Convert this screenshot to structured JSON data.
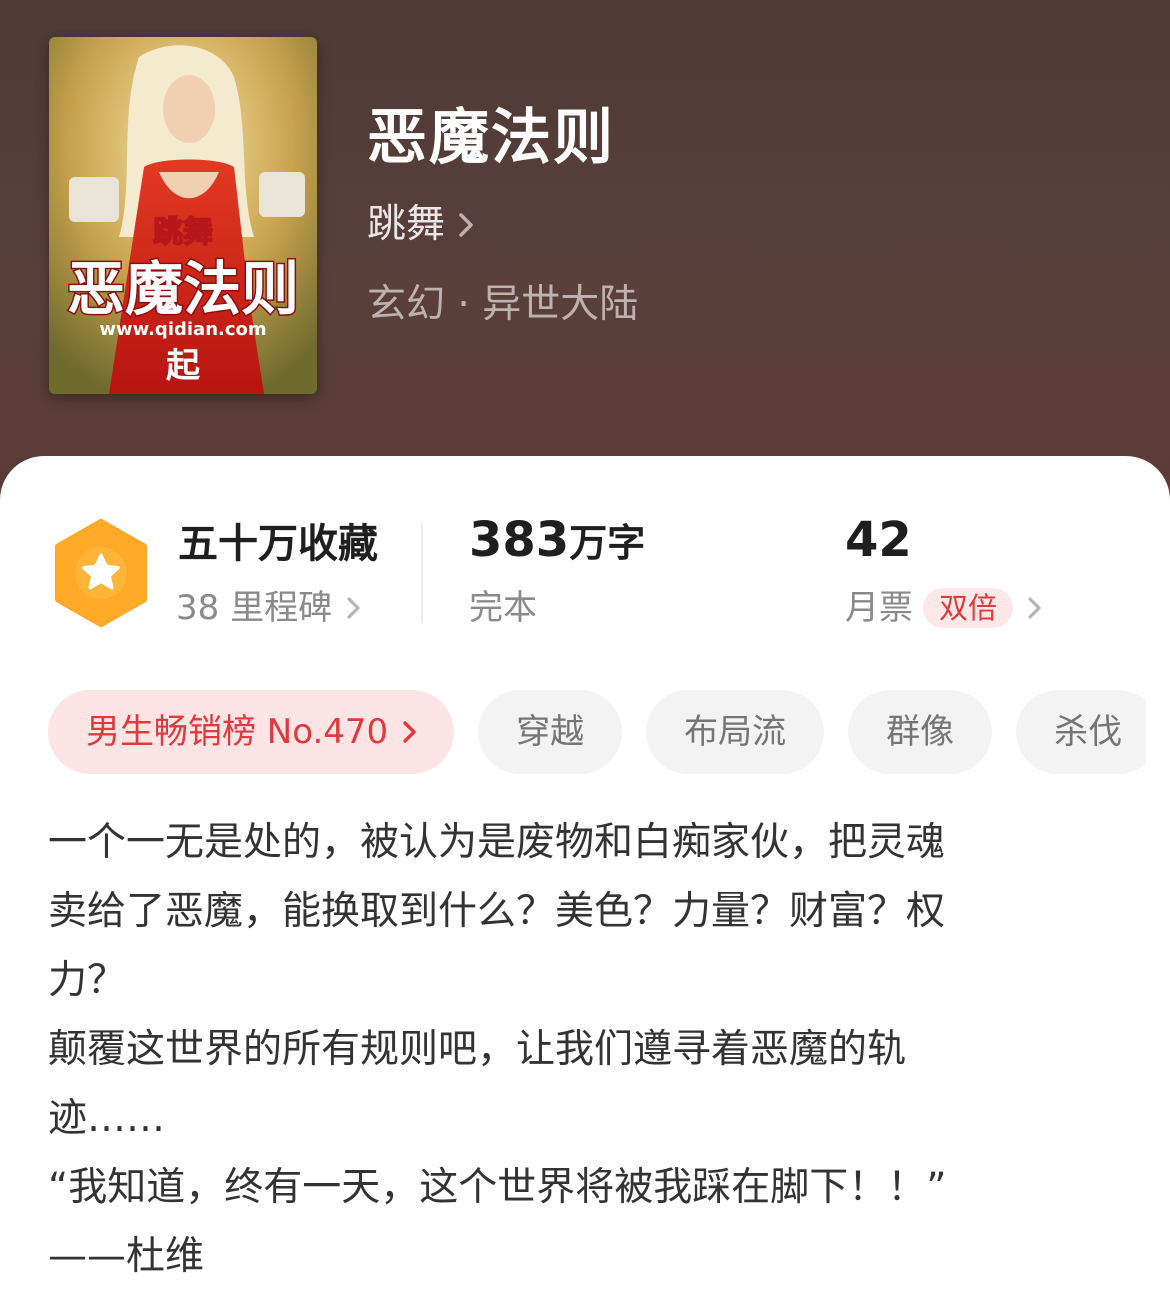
{
  "book": {
    "title": "恶魔法则",
    "author": "跳舞",
    "genre": "玄幻 · 异世大陆",
    "cover": {
      "author_text": "跳舞",
      "title_text": "恶魔法则",
      "url_text": "www.qidian.com",
      "logo_text": "起"
    }
  },
  "stats": {
    "collection": {
      "title": "五十万收藏",
      "sub": "38 里程碑"
    },
    "words": {
      "number": "383",
      "unit": "万字",
      "sub": "完本"
    },
    "monthly": {
      "number": "42",
      "sub": "月票",
      "badge": "双倍"
    }
  },
  "tags": {
    "rank": "男生畅销榜 No.470",
    "items": [
      "穿越",
      "布局流",
      "群像",
      "杀伐"
    ]
  },
  "description": "一个一无是处的，被认为是废物和白痴家伙，把灵魂\n卖给了恶魔，能换取到什么？美色？力量？财富？权\n力？\n颠覆这世界的所有规则吧，让我们遵寻着恶魔的轨\n迹……\n“我知道，终有一天，这个世界将被我踩在脚下！！”\n——杜维",
  "colors": {
    "header_bg": "#553d39",
    "accent_red": "#e0393e",
    "badge_orange": "#ffa928"
  }
}
